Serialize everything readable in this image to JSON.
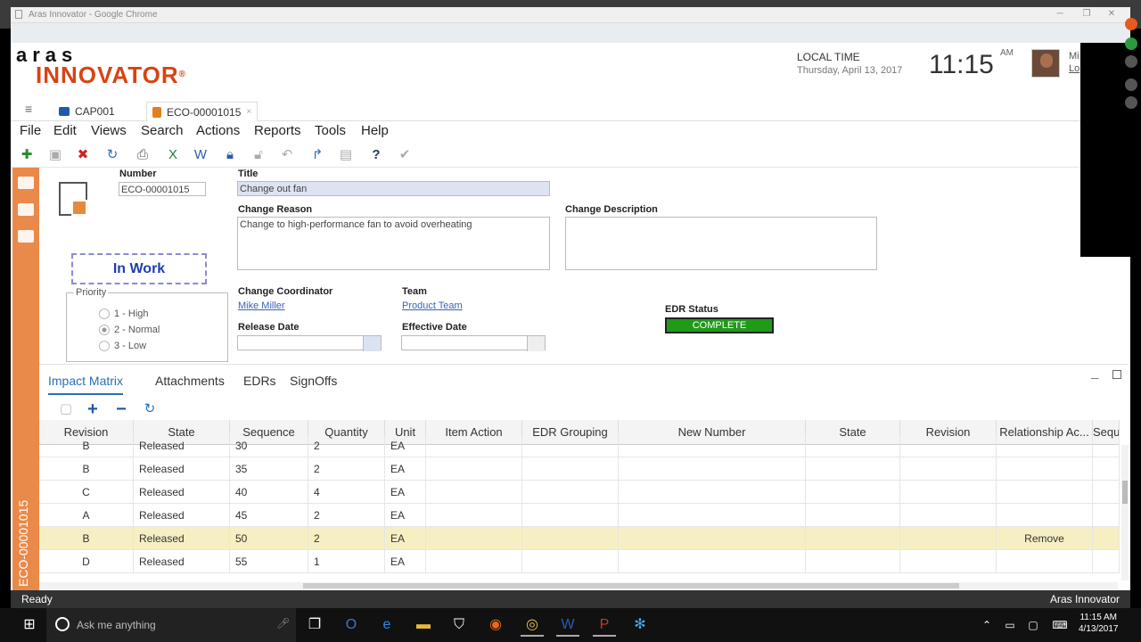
{
  "browser": {
    "title": "Aras Innovator - Google Chrome"
  },
  "header": {
    "logo_top": "aras",
    "logo_bottom": "INNOVATOR",
    "logo_mark": "®",
    "local_time_label": "LOCAL TIME",
    "date": "Thursday, April 13, 2017",
    "time": "11:15",
    "ampm": "AM",
    "user_short": "Mi",
    "user_short2": "Lo"
  },
  "tabs": [
    {
      "label": "CAP001"
    },
    {
      "label": "ECO-00001015",
      "close": "×"
    }
  ],
  "menu": [
    "File",
    "Edit",
    "Views",
    "Search",
    "Actions",
    "Reports",
    "Tools",
    "Help"
  ],
  "form": {
    "number_label": "Number",
    "number_value": "ECO-00001015",
    "title_label": "Title",
    "title_value": "Change out fan",
    "reason_label": "Change Reason",
    "reason_value": "Change to high-performance fan to avoid overheating",
    "description_label": "Change Description",
    "description_value": "",
    "state": "In Work",
    "priority_label": "Priority",
    "priority_options": [
      "1 - High",
      "2 - Normal",
      "3 - Low"
    ],
    "priority_selected": "2 - Normal",
    "coordinator_label": "Change Coordinator",
    "coordinator_value": "Mike Miller",
    "team_label": "Team",
    "team_value": "Product Team",
    "release_date_label": "Release Date",
    "effective_date_label": "Effective Date",
    "edr_status_label": "EDR Status",
    "edr_status_value": "COMPLETE",
    "colors": {
      "edr": "#1f9a1a",
      "state_border": "#8a8ad8",
      "accent": "#2a6ebb"
    }
  },
  "sidebar": {
    "vertical_title": "ECO-00001015"
  },
  "relationships": {
    "tabs": [
      "Impact Matrix",
      "Attachments",
      "EDRs",
      "SignOffs"
    ],
    "active_tab": "Impact Matrix",
    "columns": [
      "Revision",
      "State",
      "Sequence",
      "Quantity",
      "Unit",
      "Item Action",
      "EDR Grouping",
      "New Number",
      "State",
      "Revision",
      "Relationship Ac...",
      "Sequ"
    ],
    "rows": [
      [
        "B",
        "Released",
        "30",
        "2",
        "EA",
        "",
        "",
        "",
        "",
        "",
        "",
        ""
      ],
      [
        "B",
        "Released",
        "35",
        "2",
        "EA",
        "",
        "",
        "",
        "",
        "",
        "",
        ""
      ],
      [
        "C",
        "Released",
        "40",
        "4",
        "EA",
        "",
        "",
        "",
        "",
        "",
        "",
        ""
      ],
      [
        "A",
        "Released",
        "45",
        "2",
        "EA",
        "",
        "",
        "",
        "",
        "",
        "",
        ""
      ],
      [
        "B",
        "Released",
        "50",
        "2",
        "EA",
        "",
        "",
        "",
        "",
        "",
        "Remove",
        ""
      ],
      [
        "D",
        "Released",
        "55",
        "1",
        "EA",
        "",
        "",
        "",
        "",
        "",
        "",
        ""
      ]
    ],
    "selected_row": 4
  },
  "status": {
    "left": "Ready",
    "right": "Aras Innovator"
  },
  "taskbar": {
    "search_placeholder": "Ask me anything",
    "time": "11:15 AM",
    "date": "4/13/2017"
  }
}
